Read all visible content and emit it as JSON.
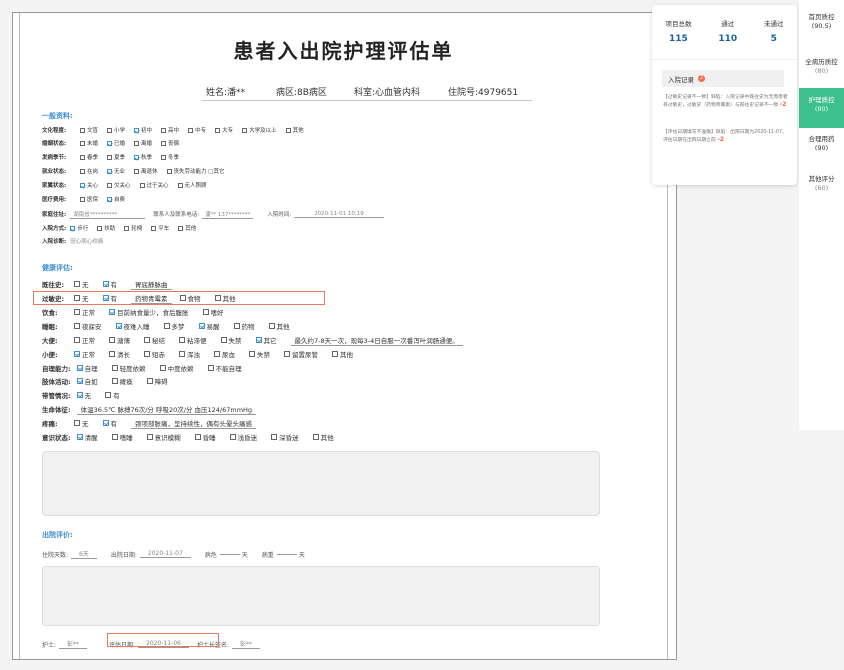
{
  "form": {
    "title": "患者入出院护理评估单",
    "patient": {
      "name": "姓名:潘**",
      "ward": "病区:8B病区",
      "dept": "科室:心血管内科",
      "inpatient_no": "住院号:4979651"
    },
    "general_section": "一般资料:",
    "general_rows": [
      {
        "label": "文化程度:",
        "options": [
          {
            "text": "文盲",
            "on": false
          },
          {
            "text": "小学",
            "on": false
          },
          {
            "text": "初中",
            "on": true
          },
          {
            "text": "高中",
            "on": false
          },
          {
            "text": "中专",
            "on": false
          },
          {
            "text": "大专",
            "on": false
          },
          {
            "text": "大学及以上",
            "on": false
          },
          {
            "text": "其他",
            "on": false
          }
        ]
      },
      {
        "label": "婚姻状态:",
        "options": [
          {
            "text": "未婚",
            "on": false
          },
          {
            "text": "已婚",
            "on": true
          },
          {
            "text": "离婚",
            "on": false
          },
          {
            "text": "丧偶",
            "on": false
          }
        ]
      },
      {
        "label": "发病季节:",
        "options": [
          {
            "text": "春季",
            "on": false
          },
          {
            "text": "夏季",
            "on": false
          },
          {
            "text": "秋季",
            "on": true
          },
          {
            "text": "冬季",
            "on": false
          }
        ]
      },
      {
        "label": "就业状态:",
        "options": [
          {
            "text": "在岗",
            "on": false
          },
          {
            "text": "无业",
            "on": true
          },
          {
            "text": "离退休",
            "on": false
          },
          {
            "text": "丧失劳动能力 □其它",
            "on": false
          }
        ]
      },
      {
        "label": "家属状态:",
        "options": [
          {
            "text": "关心",
            "on": true
          },
          {
            "text": "欠关心",
            "on": false
          },
          {
            "text": "过于关心",
            "on": false
          },
          {
            "text": "无人照顾",
            "on": false
          }
        ]
      },
      {
        "label": "医疗费用:",
        "options": [
          {
            "text": "医保",
            "on": false
          },
          {
            "text": "自费",
            "on": true
          }
        ]
      }
    ],
    "address": {
      "label": "家庭住址:",
      "value": "湖南省**********",
      "contact_label": "联系人及联系电话:",
      "contact_value": "潘** 137********",
      "admit_time_label": "入院时间:",
      "admit_time_value": "2020-11-01 10:19"
    },
    "admit_mode": {
      "label": "入院方式:",
      "options": [
        {
          "text": "步行",
          "on": true
        },
        {
          "text": "扶助",
          "on": false
        },
        {
          "text": "轮椅",
          "on": false
        },
        {
          "text": "平车",
          "on": false
        },
        {
          "text": "其他",
          "on": false
        }
      ]
    },
    "diagnosis": {
      "label": "入院诊断:",
      "value": "冠心病心绞痛"
    },
    "health_section": "健康评估:",
    "health_rows": [
      {
        "label": "既往史:",
        "items": [
          {
            "t": "cb",
            "text": "无",
            "on": false
          },
          {
            "t": "cb",
            "text": "有",
            "on": true
          },
          {
            "t": "val",
            "text": "胃底静脉曲"
          }
        ]
      },
      {
        "label": "过敏史:",
        "items": [
          {
            "t": "cb",
            "text": "无",
            "on": false
          },
          {
            "t": "cb",
            "text": "有",
            "on": true
          },
          {
            "t": "val",
            "text": "药物青霉素"
          },
          {
            "t": "cb",
            "text": "食物",
            "on": false
          },
          {
            "t": "cb",
            "text": "其他",
            "on": false
          }
        ]
      },
      {
        "label": "饮食:",
        "items": [
          {
            "t": "cb",
            "text": "正常",
            "on": false
          },
          {
            "t": "cb",
            "text": "目前纳食量少，食后腹胀",
            "on": true
          },
          {
            "t": "cb",
            "text": "嗜好",
            "on": false
          }
        ]
      },
      {
        "label": "睡眠:",
        "items": [
          {
            "t": "cb",
            "text": "夜寐安",
            "on": false
          },
          {
            "t": "cb",
            "text": "夜难入睡",
            "on": true
          },
          {
            "t": "cb",
            "text": "多梦",
            "on": false
          },
          {
            "t": "cb",
            "text": "易醒",
            "on": true
          },
          {
            "t": "cb",
            "text": "药物",
            "on": false
          },
          {
            "t": "cb",
            "text": "其他",
            "on": false
          }
        ]
      },
      {
        "label": "大便:",
        "items": [
          {
            "t": "cb",
            "text": "正常",
            "on": false
          },
          {
            "t": "cb",
            "text": "溏薄",
            "on": false
          },
          {
            "t": "cb",
            "text": "秘结",
            "on": false
          },
          {
            "t": "cb",
            "text": "粘滞便",
            "on": false
          },
          {
            "t": "cb",
            "text": "失禁",
            "on": false
          },
          {
            "t": "cb",
            "text": "其它",
            "on": true
          },
          {
            "t": "val",
            "text": "最久约7-8天一次，现每3-4日自服一次番泻叶润肠通便。"
          }
        ]
      },
      {
        "label": "小便:",
        "items": [
          {
            "t": "cb",
            "text": "正常",
            "on": true
          },
          {
            "t": "cb",
            "text": "清长",
            "on": false
          },
          {
            "t": "cb",
            "text": "短赤",
            "on": false
          },
          {
            "t": "cb",
            "text": "浑浊",
            "on": false
          },
          {
            "t": "cb",
            "text": "尿血",
            "on": false
          },
          {
            "t": "cb",
            "text": "失禁",
            "on": false
          },
          {
            "t": "cb",
            "text": "留置尿管",
            "on": false
          },
          {
            "t": "cb",
            "text": "其他",
            "on": false
          }
        ]
      },
      {
        "label": "自理能力:",
        "items": [
          {
            "t": "cb",
            "text": "自理",
            "on": true
          },
          {
            "t": "cb",
            "text": "轻度依赖",
            "on": false
          },
          {
            "t": "cb",
            "text": "中度依赖",
            "on": false
          },
          {
            "t": "cb",
            "text": "不能自理",
            "on": false
          }
        ]
      },
      {
        "label": "肢体活动:",
        "items": [
          {
            "t": "cb",
            "text": "自如",
            "on": true
          },
          {
            "t": "cb",
            "text": "瘫痪",
            "on": false
          },
          {
            "t": "cb",
            "text": "障碍",
            "on": false
          }
        ]
      },
      {
        "label": "带管情况:",
        "items": [
          {
            "t": "cb",
            "text": "无",
            "on": true
          },
          {
            "t": "cb",
            "text": "有",
            "on": false
          }
        ]
      },
      {
        "label": "生命体征:",
        "items": [
          {
            "t": "val",
            "text": "体温36.5℃ 脉搏76次/分 呼吸20次/分 血压124/67mmHg"
          }
        ]
      },
      {
        "label": "疼痛:",
        "items": [
          {
            "t": "cb",
            "text": "无",
            "on": false
          },
          {
            "t": "cb",
            "text": "有",
            "on": true
          },
          {
            "t": "val",
            "text": "颈项部胀痛，呈持续性，偶有头晕头痛感"
          }
        ]
      },
      {
        "label": "意识状态:",
        "items": [
          {
            "t": "cb",
            "text": "清醒",
            "on": true
          },
          {
            "t": "cb",
            "text": "嗜睡",
            "on": false
          },
          {
            "t": "cb",
            "text": "意识模糊",
            "on": false
          },
          {
            "t": "cb",
            "text": "昏睡",
            "on": false
          },
          {
            "t": "cb",
            "text": "浅昏迷",
            "on": false
          },
          {
            "t": "cb",
            "text": "深昏迷",
            "on": false
          },
          {
            "t": "cb",
            "text": "其他",
            "on": false
          }
        ]
      }
    ],
    "discharge_section": "出院评价:",
    "discharge": {
      "stay_label": "住院天数:",
      "stay_value": "6天",
      "date_label": "出院日期:",
      "date_value": "2020-11-07",
      "cure_label": "病危",
      "cure_unit": "天",
      "serious_label": "病重",
      "serious_unit": "天"
    },
    "sign": {
      "nurse_label": "护士:",
      "nurse_value": "彭**",
      "eval_date_label": "评估日期:",
      "eval_date_value": "2020-11-06",
      "head_label": "护士长签名:",
      "head_value": "彭**"
    }
  },
  "stats": {
    "total_label": "项目总数",
    "total_value": "115",
    "pass_label": "通过",
    "pass_value": "110",
    "fail_label": "未通过",
    "fail_value": "5"
  },
  "records": {
    "tab_label": "入院记录",
    "badge": "2",
    "errors": [
      {
        "text": "【过敏史记录不一致】缺陷：入院记录中既往史为无而患者有过敏史，过敏史（药物青霉素）与既往史记录不一致",
        "score": "-2"
      },
      {
        "text": "【评估日期填写不准确】缺陷：出院日期为2020-11-07，评估日期在出院日期之前",
        "score": "-2"
      }
    ]
  },
  "sidebar": [
    {
      "label": "首页质控",
      "score": "(90.5)",
      "active": false
    },
    {
      "label": "全病历质控",
      "score": "(80)",
      "active": false
    },
    {
      "label": "护理质控",
      "score": "(90)",
      "active": true
    },
    {
      "label": "合理用药",
      "score": "(90)",
      "active": false
    },
    {
      "label": "其他评分",
      "score": "(60)",
      "active": false
    }
  ]
}
